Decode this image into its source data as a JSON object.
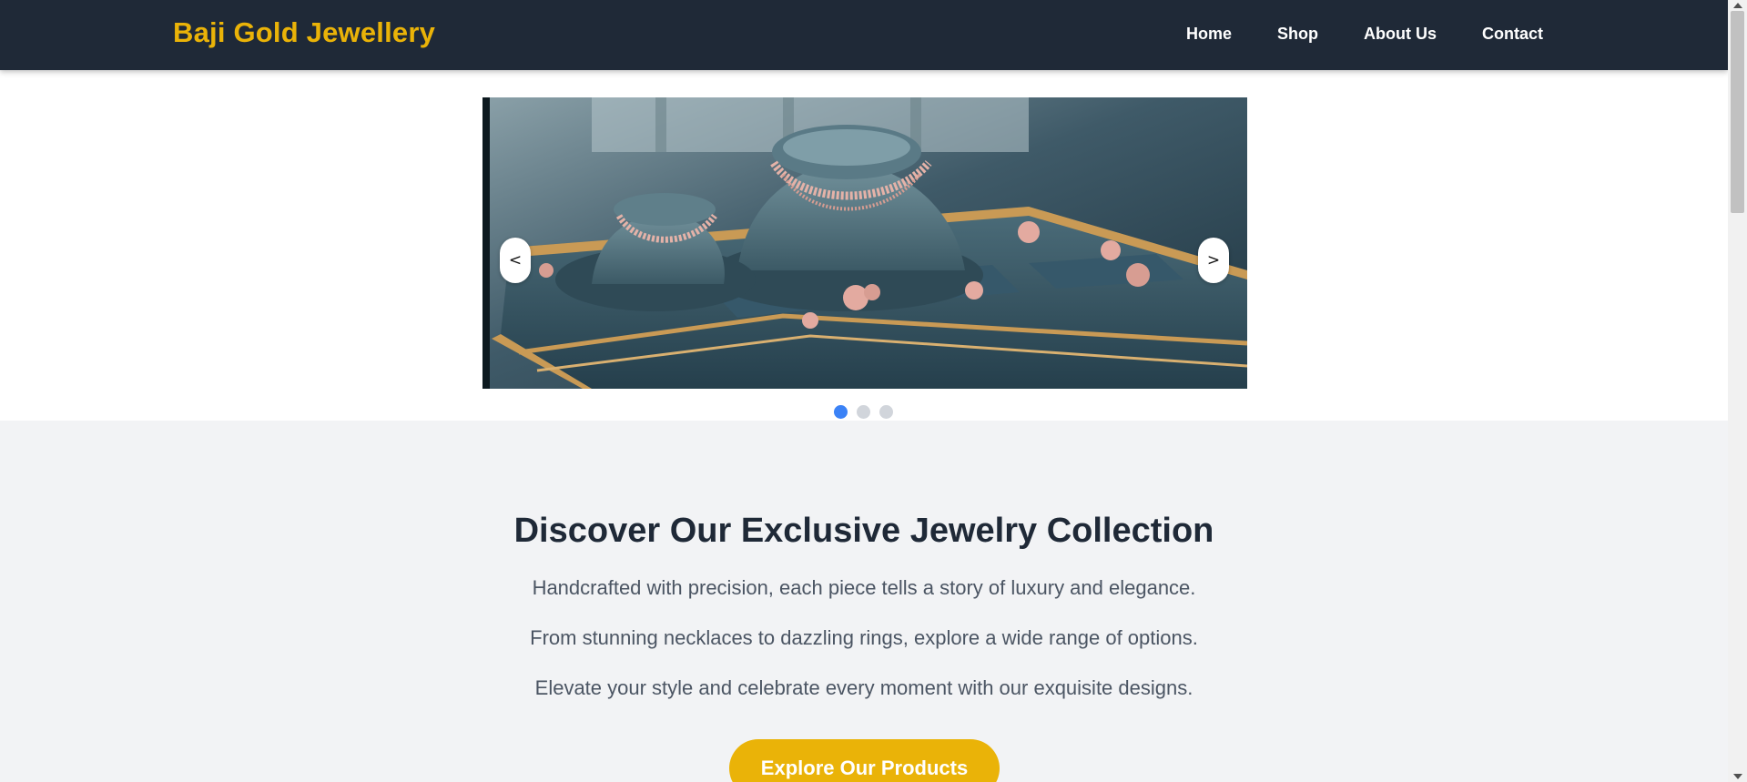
{
  "header": {
    "brand": "Baji Gold Jewellery",
    "nav": [
      {
        "label": "Home"
      },
      {
        "label": "Shop"
      },
      {
        "label": "About Us"
      },
      {
        "label": "Contact"
      }
    ]
  },
  "carousel": {
    "prev_label": "<",
    "next_label": ">",
    "slide_count": 3,
    "active_slide": 1,
    "image_description_icon": "jewelry-display-image"
  },
  "content": {
    "heading": "Discover Our Exclusive Jewelry Collection",
    "paragraphs": [
      "Handcrafted with precision, each piece tells a story of luxury and elegance.",
      "From stunning necklaces to dazzling rings, explore a wide range of options.",
      "Elevate your style and celebrate every moment with our exquisite designs."
    ],
    "cta_label": "Explore Our Products"
  },
  "colors": {
    "header_bg": "#1f2937",
    "brand": "#eab308",
    "accent_dot": "#3b82f6",
    "cta_bg": "#eab308",
    "section_bg": "#f2f3f5"
  }
}
